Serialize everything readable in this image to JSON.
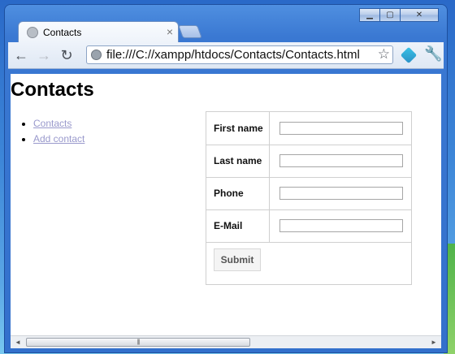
{
  "window": {
    "controls": {
      "minimize": "▁",
      "maximize": "▢",
      "close": "✕"
    }
  },
  "tab": {
    "title": "Contacts",
    "close_glyph": "×"
  },
  "toolbar": {
    "back_glyph": "←",
    "forward_glyph": "→",
    "reload_glyph": "↻",
    "url": "file:///C://xampp/htdocs/Contacts/Contacts.html",
    "star_glyph": "☆",
    "wrench_glyph": "🔧"
  },
  "page": {
    "title": "Contacts",
    "nav": [
      {
        "label": "Contacts"
      },
      {
        "label": "Add contact"
      }
    ],
    "form": {
      "fields": [
        {
          "label": "First name",
          "value": ""
        },
        {
          "label": "Last name",
          "value": ""
        },
        {
          "label": "Phone",
          "value": ""
        },
        {
          "label": "E-Mail",
          "value": ""
        }
      ],
      "submit_label": "Submit"
    }
  },
  "scrollbar": {
    "left_glyph": "◄",
    "right_glyph": "►",
    "thumb_grip": "|||"
  },
  "icons": {
    "tab_favicon": "page-icon",
    "omnibox": "page-icon",
    "extension": "extension-icon",
    "bookmark": "star-icon",
    "menu": "wrench-icon"
  }
}
